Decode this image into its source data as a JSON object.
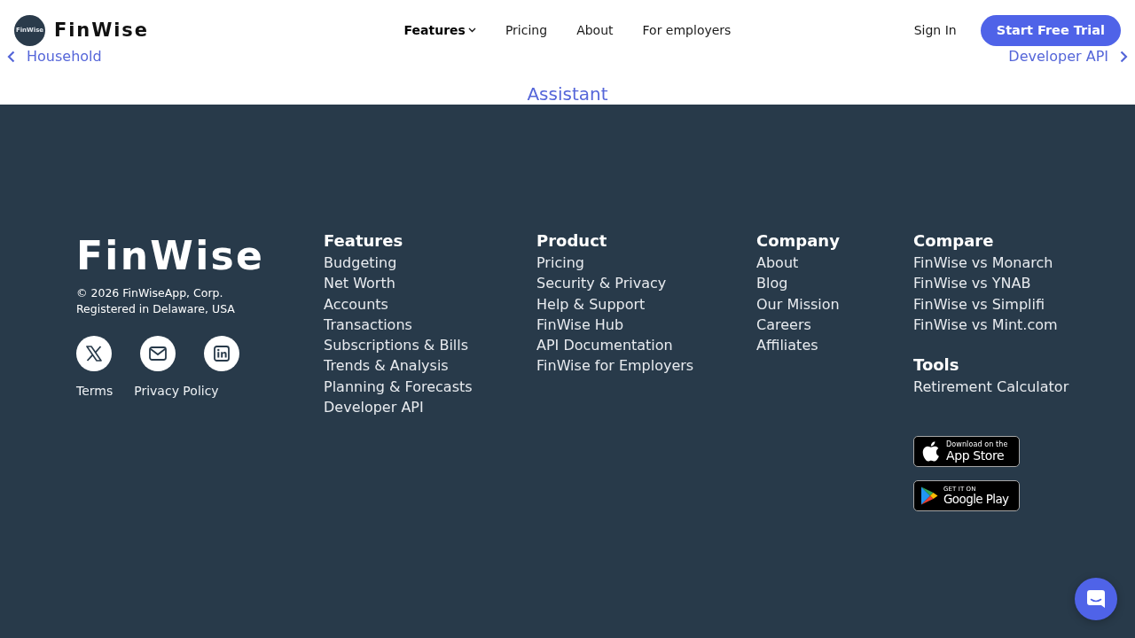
{
  "header": {
    "logo": {
      "badge_text": "FinWise",
      "wordmark": "FinWise"
    },
    "nav": [
      {
        "label": "Features",
        "selected": true,
        "dropdown": true
      },
      {
        "label": "Pricing",
        "selected": false,
        "dropdown": false
      },
      {
        "label": "About",
        "selected": false,
        "dropdown": false
      },
      {
        "label": "For employers",
        "selected": false,
        "dropdown": false
      }
    ],
    "sign_in": "Sign In",
    "cta_button": "Start Free Trial"
  },
  "feature_carousel": {
    "previous": "Household",
    "current": "Assistant",
    "next": "Developer API"
  },
  "footer": {
    "brand": {
      "name": "FinWise",
      "copyright": "© 2026 FinWiseApp, Corp.",
      "registration": "Registered in Delaware, USA",
      "social_links": [
        {
          "kind": "x"
        },
        {
          "kind": "mail"
        },
        {
          "kind": "linkedin"
        }
      ],
      "legal_links": [
        "Terms",
        "Privacy Policy"
      ]
    },
    "columns": [
      {
        "sections": [
          {
            "heading": "Features",
            "links": [
              "Budgeting",
              "Net Worth",
              "Accounts",
              "Transactions",
              "Subscriptions & Bills",
              "Trends & Analysis",
              "Planning & Forecasts",
              "Developer API"
            ]
          }
        ]
      },
      {
        "sections": [
          {
            "heading": "Product",
            "links": [
              "Pricing",
              "Security & Privacy",
              "Help & Support",
              "FinWise Hub",
              "API Documentation",
              "FinWise for Employers"
            ]
          }
        ]
      },
      {
        "sections": [
          {
            "heading": "Company",
            "links": [
              "About",
              "Blog",
              "Our Mission",
              "Careers",
              "Affiliates"
            ]
          }
        ]
      },
      {
        "sections": [
          {
            "heading": "Compare",
            "links": [
              "FinWise vs Monarch",
              "FinWise vs YNAB",
              "FinWise vs Simplifi",
              "FinWise vs Mint.com"
            ]
          },
          {
            "heading": "Tools",
            "links": [
              "Retirement Calculator"
            ]
          }
        ],
        "app_badges": [
          {
            "kind": "apple",
            "small_text": "Download on the",
            "large_text": "App Store"
          },
          {
            "kind": "google-play",
            "small_text": "GET IT ON",
            "large_text": "Google Play"
          }
        ]
      }
    ]
  }
}
